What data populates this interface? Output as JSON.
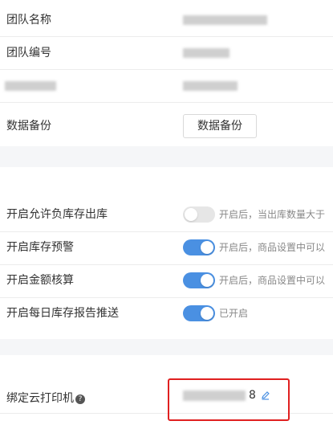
{
  "team_info": {
    "team_name_label": "团队名称",
    "team_number_label": "团队编号",
    "backup_label": "数据备份",
    "backup_button": "数据备份"
  },
  "inventory_settings": {
    "allow_negative": {
      "label": "开启允许负库存出库",
      "enabled": false,
      "hint": "开启后，当出库数量大于"
    },
    "stock_warning": {
      "label": "开启库存预警",
      "enabled": true,
      "hint": "开启后，商品设置中可以"
    },
    "amount_check": {
      "label": "开启金额核算",
      "enabled": true,
      "hint": "开启后，商品设置中可以"
    },
    "daily_report": {
      "label": "开启每日库存报告推送",
      "enabled": true,
      "hint": "已开启"
    }
  },
  "printer": {
    "label": "绑定云打印机",
    "help_icon": "?",
    "value_suffix": "8"
  },
  "colors": {
    "switch_on": "#4a90e2",
    "switch_off": "#e6e6e6",
    "highlight": "#e02020"
  }
}
